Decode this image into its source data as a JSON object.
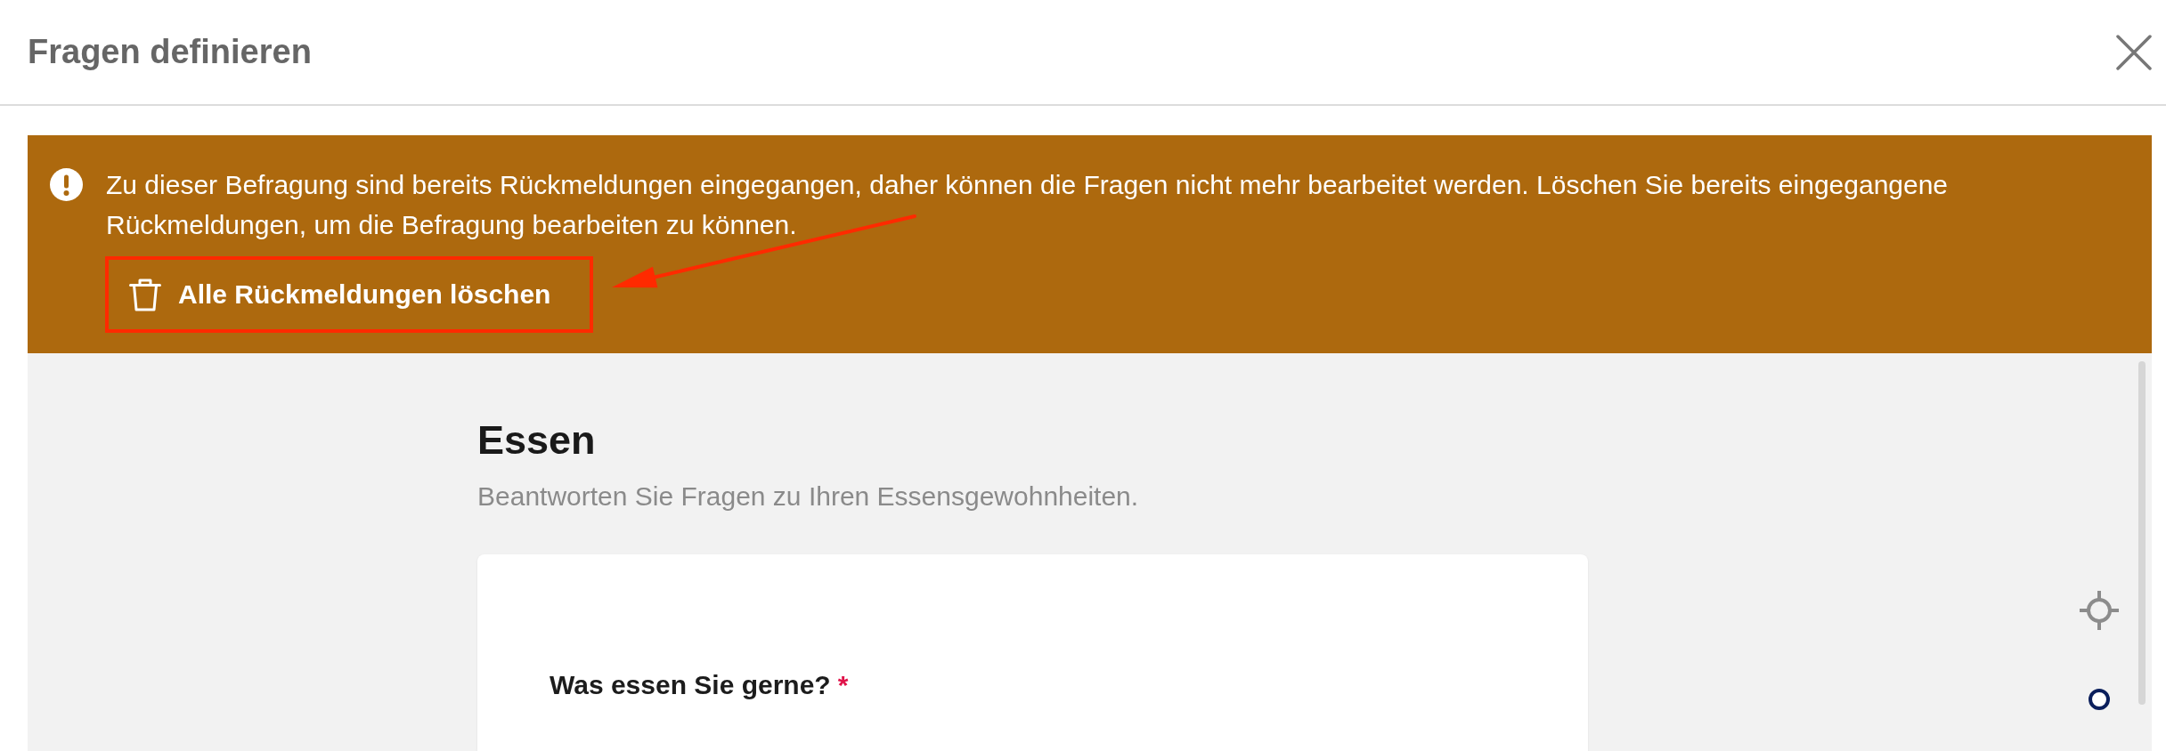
{
  "dialog": {
    "title": "Fragen definieren"
  },
  "notice": {
    "message": "Zu dieser Befragung sind bereits Rückmeldungen eingegangen, daher können die Fragen nicht mehr bearbeitet werden. Löschen Sie bereits eingegangene Rückmeldungen, um die Befragung bearbeiten zu können.",
    "action": {
      "label": "Alle Rückmeldungen löschen",
      "highlighted": true
    },
    "pointer_arrow": true
  },
  "section": {
    "title": "Essen",
    "description": "Beantworten Sie Fragen zu Ihren Essensgewohnheiten."
  },
  "questions": [
    {
      "text": "Was essen Sie gerne?",
      "required_mark": "*"
    }
  ]
}
